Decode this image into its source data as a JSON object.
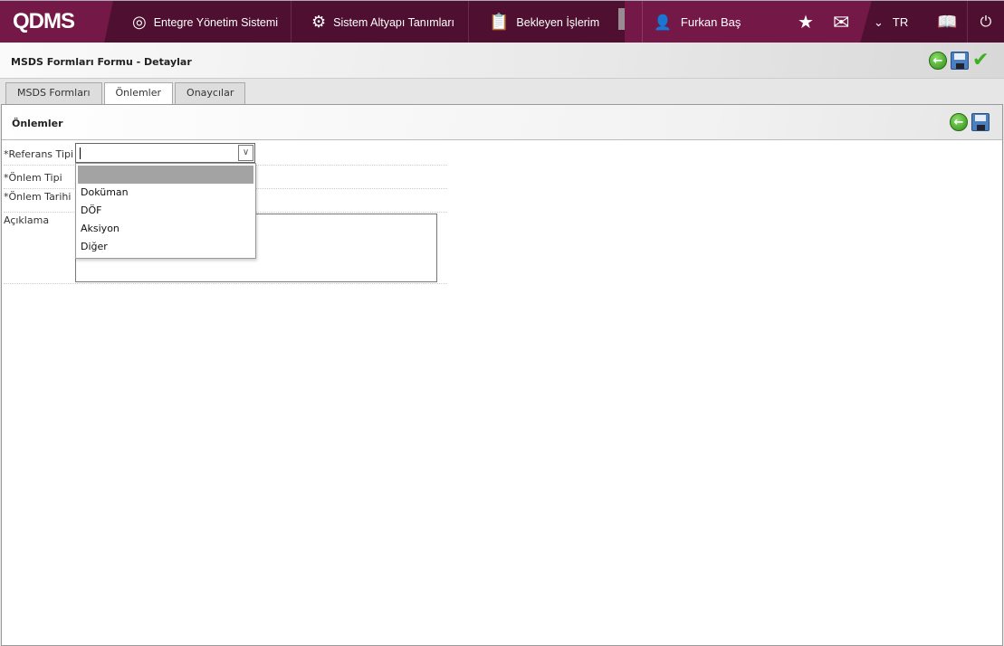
{
  "header": {
    "logo": "QDMS",
    "nav": [
      {
        "label": "Entegre Yönetim Sistemi",
        "icon": "qdms-icon"
      },
      {
        "label": "Sistem Altyapı Tanımları",
        "icon": "gear-icon"
      },
      {
        "label": "Bekleyen İşlerim",
        "icon": "clipboard-icon"
      }
    ],
    "user": "Furkan Baş",
    "language": "TR"
  },
  "page": {
    "title": "MSDS Formları Formu - Detaylar"
  },
  "tabs": [
    "MSDS Formları",
    "Önlemler",
    "Onaycılar"
  ],
  "panel": {
    "title": "Önlemler"
  },
  "form": {
    "referans_tipi": "*Referans Tipi",
    "onlem_tipi": "*Önlem Tipi",
    "onlem_tarihi": "*Önlem Tarihi",
    "aciklama": "Açıklama"
  },
  "dropdown": {
    "options": [
      "",
      "Doküman",
      "DÖF",
      "Aksiyon",
      "Diğer"
    ]
  }
}
